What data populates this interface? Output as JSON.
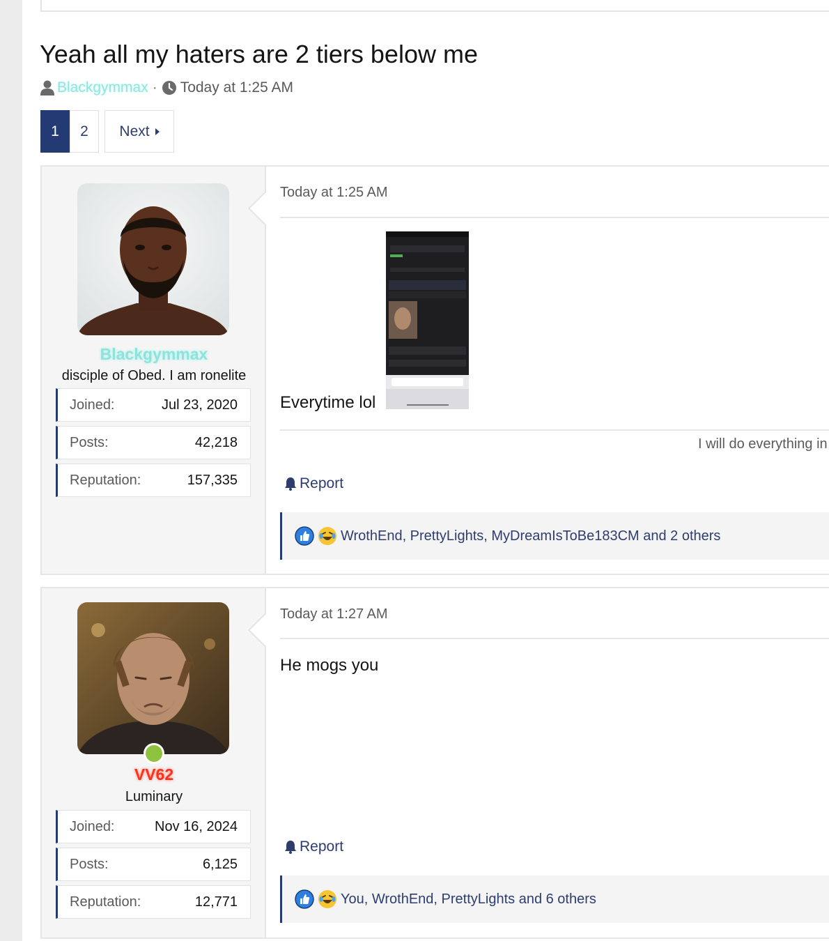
{
  "thread": {
    "title": "Yeah all my haters are 2 tiers below me",
    "author": "Blackgymmax",
    "separator": "·",
    "time": "Today at 1:25 AM"
  },
  "pager": {
    "pages": [
      "1",
      "2"
    ],
    "current": "1",
    "next_label": "Next"
  },
  "posts": [
    {
      "user": {
        "name": "Blackgymmax",
        "title": "disciple of Obed. I am ronelite",
        "stats": [
          {
            "label": "Joined:",
            "value": "Jul 23, 2020"
          },
          {
            "label": "Posts:",
            "value": "42,218"
          },
          {
            "label": "Reputation:",
            "value": "157,335"
          }
        ]
      },
      "time": "Today at 1:25 AM",
      "message": "Everytime lol",
      "signature": "I will do everything in",
      "report_label": "Report",
      "reactions": "WrothEnd, PrettyLights, MyDreamIsToBe183CM and 2 others"
    },
    {
      "user": {
        "name": "VV62",
        "title": "Luminary",
        "stats": [
          {
            "label": "Joined:",
            "value": "Nov 16, 2024"
          },
          {
            "label": "Posts:",
            "value": "6,125"
          },
          {
            "label": "Reputation:",
            "value": "12,771"
          }
        ]
      },
      "time": "Today at 1:27 AM",
      "message": "He mogs you",
      "report_label": "Report",
      "reactions": "You, WrothEnd, PrettyLights and 6 others"
    }
  ],
  "colors": {
    "accent": "#243a73",
    "link": "#2d3d6e",
    "username_cyan": "#8ee3dc",
    "username_red": "#ff2f1f",
    "online": "#8ec23f"
  },
  "icons": [
    "user-icon",
    "clock-icon",
    "caret-right-icon",
    "bell-icon",
    "like-icon",
    "laugh-icon"
  ]
}
